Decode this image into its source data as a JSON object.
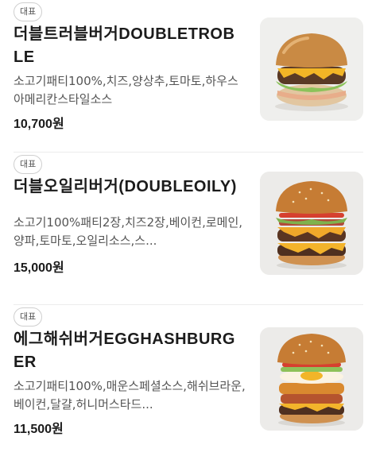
{
  "items": [
    {
      "badge": "대표",
      "name": "더블트러블버거DOUBLETROBLE",
      "description": "소고기패티100%,치즈,양상추,토마토,하우스아메리칸스타일소스",
      "price": "10,700원",
      "image_icon": "burger-photo"
    },
    {
      "badge": "대표",
      "name": "더블오일리버거(DOUBLEOILY)",
      "description": "소고기100%패티2장,치즈2장,베이컨,로메인,양파,토마토,오일리소스,스...",
      "price": "15,000원",
      "image_icon": "burger-photo"
    },
    {
      "badge": "대표",
      "name": "에그해쉬버거EGGHASHBURGER",
      "description": "소고기패티100%,매운스페셜소스,해쉬브라운,베이컨,달걀,허니머스타드...",
      "price": "11,500원",
      "image_icon": "burger-photo"
    }
  ]
}
